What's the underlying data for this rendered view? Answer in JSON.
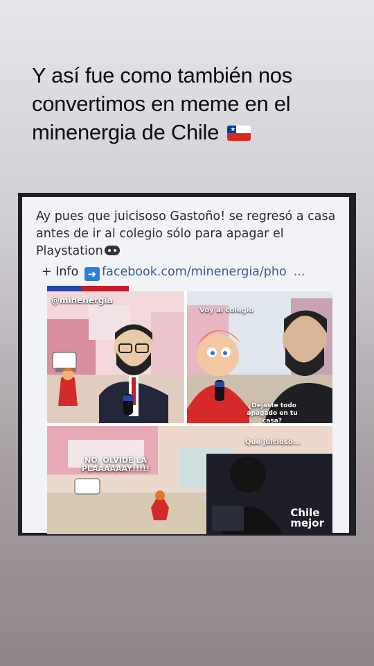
{
  "story": {
    "caption": "Y así fue como también nos convertimos en meme en el minenergia de Chile",
    "flag_icon": "chile-flag-icon"
  },
  "post": {
    "text": "Ay pues que juicisoso Gastoño! se regresó a casa antes de ir al colegio sólo para apagar el Playstation",
    "info_label": "+ Info",
    "link": "facebook.com/minenergia/pho",
    "more": "..."
  },
  "comic": {
    "handle": "@minenergia",
    "panel2_tag": "Voy al colegio",
    "question": "¿Dejaste todo apagado en tu casa?",
    "shout": "NO, OLVIDÉ LA PLAAAAAAY!!!!!",
    "juicioso": "Qué juicioso...",
    "brand_line1": "Chile",
    "brand_line2": "mejor"
  },
  "colors": {
    "flag_blue": "#0039a6",
    "flag_red": "#d52b1e",
    "link": "#3b5a9a",
    "arrow": "#2f7fd8"
  }
}
